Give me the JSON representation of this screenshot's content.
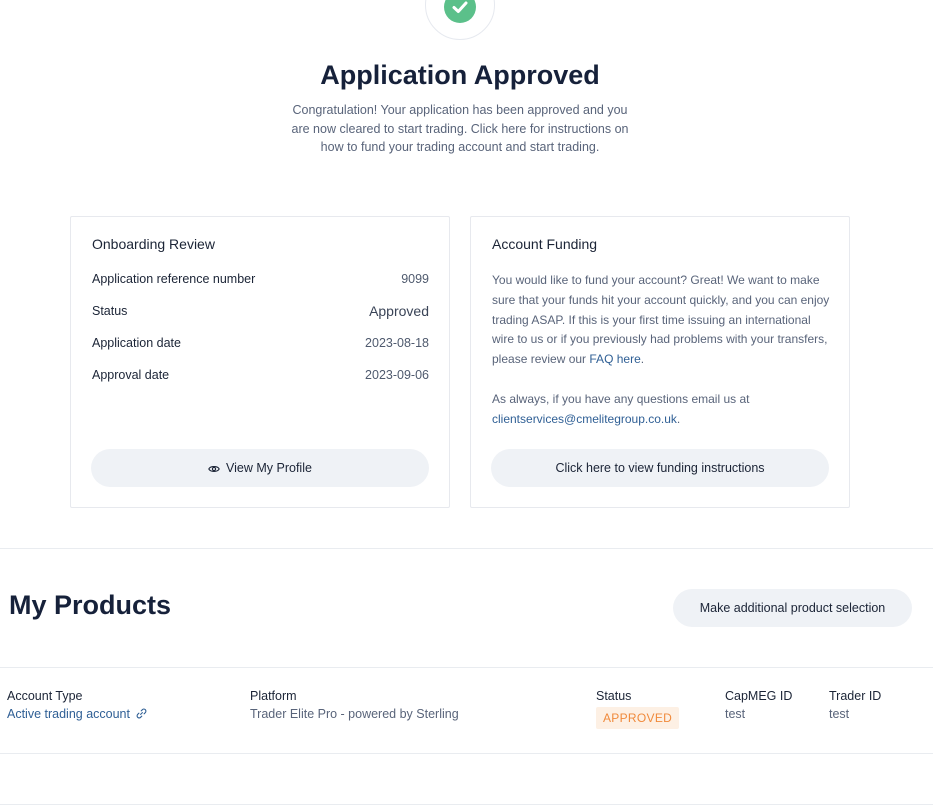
{
  "hero": {
    "title": "Application Approved",
    "message": "Congratulation! Your application has been approved and you are now cleared to start trading. Click here for instructions on how to fund your trading account and start trading."
  },
  "onboarding": {
    "title": "Onboarding Review",
    "rows": [
      {
        "label": "Application reference number",
        "value": "9099"
      },
      {
        "label": "Status",
        "value": "Approved"
      },
      {
        "label": "Application date",
        "value": "2023-08-18"
      },
      {
        "label": "Approval date",
        "value": "2023-09-06"
      }
    ],
    "profile_button": "View My Profile"
  },
  "funding": {
    "title": "Account Funding",
    "paragraph1_before_link": "You would like to fund your account? Great! We want to make sure that your funds hit your account quickly, and you can enjoy trading ASAP. If this is your first time issuing an international wire to us or if you previously had problems with your transfers, please review our ",
    "faq_link": "FAQ here",
    "paragraph1_after_link": ".",
    "paragraph2_before_email": "As always, if you have any questions email us at ",
    "email": "clientservices@cmelitegroup.co.uk",
    "paragraph2_after_email": ".",
    "instructions_button": "Click here to view funding instructions"
  },
  "products": {
    "title": "My Products",
    "add_button": "Make additional product selection",
    "columns": {
      "account_type": "Account Type",
      "platform": "Platform",
      "status": "Status",
      "capmeg_id": "CapMEG ID",
      "trader_id": "Trader ID"
    },
    "row": {
      "account_type": "Active trading account",
      "platform": "Trader Elite Pro - powered by Sterling",
      "status": "APPROVED",
      "capmeg_id": "test",
      "trader_id": "test"
    }
  },
  "colors": {
    "success_green": "#5bc08a",
    "link_blue": "#2f5f95",
    "badge_orange": "#f08a3c",
    "badge_bg": "#fdf0e4",
    "button_bg": "#eff2f6"
  },
  "icons": [
    "check-icon",
    "eye-icon",
    "link-icon"
  ]
}
